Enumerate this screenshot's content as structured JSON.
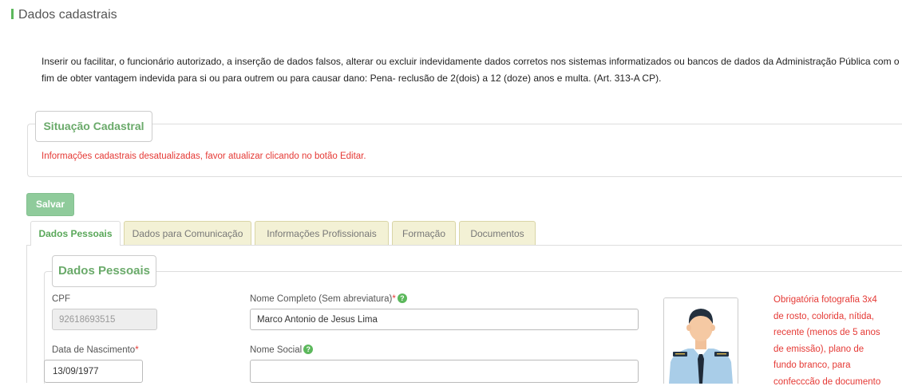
{
  "page": {
    "title": "Dados cadastrais",
    "warning": "Inserir ou facilitar, o funcionário autorizado, a inserção de dados falsos, alterar ou excluir indevidamente dados corretos nos sistemas informatizados ou bancos de dados da Administração Pública com o fim de obter vantagem indevida para si ou para outrem ou para causar dano: Pena- reclusão de 2(dois) a 12 (doze) anos e multa. (Art. 313-A CP)."
  },
  "situacao": {
    "legend": "Situação Cadastral",
    "message": "Informações cadastrais desatualizadas, favor atualizar clicando no botão Editar."
  },
  "actions": {
    "save_label": "Salvar"
  },
  "tabs": [
    {
      "label": "Dados Pessoais",
      "active": true
    },
    {
      "label": "Dados para Comunicação",
      "active": false
    },
    {
      "label": "Informações Profissionais",
      "active": false
    },
    {
      "label": "Formação",
      "active": false
    },
    {
      "label": "Documentos",
      "active": false
    }
  ],
  "dados_pessoais": {
    "legend": "Dados Pessoais",
    "cpf_label": "CPF",
    "cpf_value": "92618693515",
    "nome_label": "Nome Completo (Sem abreviatura)",
    "nome_value": "Marco Antonio de Jesus Lima",
    "nascimento_label": "Data de Nascimento",
    "nascimento_value": "13/09/1977",
    "nome_social_label": "Nome Social",
    "nome_social_value": "",
    "required_mark": "*",
    "help_mark": "?",
    "photo_note": "Obrigatória fotografia 3x4 de rosto, colorida, nítida, recente (menos de 5 anos de emissão), plano de fundo branco, para confecccão de documento"
  },
  "colors": {
    "accent": "#5cb85c",
    "error": "#e53935",
    "tab_inactive_bg": "#f3f1d5"
  }
}
